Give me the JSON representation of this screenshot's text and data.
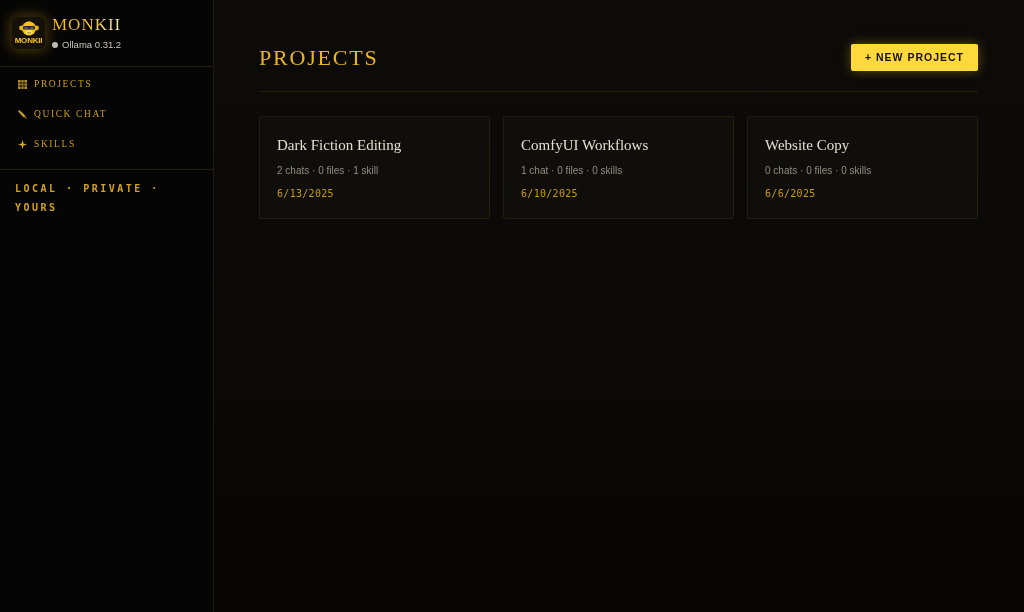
{
  "sidebar": {
    "brand": {
      "logo_text": "MONKII",
      "name": "MONKII",
      "status": "Ollama 0.31.2"
    },
    "nav": [
      {
        "label": "PROJECTS",
        "selected": false
      },
      {
        "label": "QUICK CHAT",
        "selected": false
      },
      {
        "label": "SKILLS",
        "selected": false
      }
    ],
    "footer": "LOCAL · PRIVATE · YOURS"
  },
  "main": {
    "title": "PROJECTS",
    "new_button": "+ NEW PROJECT",
    "projects": [
      {
        "name": "Dark Fiction Editing",
        "meta": "2 chats · 0 files · 1 skill",
        "date": "6/13/2025"
      },
      {
        "name": "ComfyUI Workflows",
        "meta": "1 chat · 0 files · 0 skills",
        "date": "6/10/2025"
      },
      {
        "name": "Website Copy",
        "meta": "0 chats · 0 files · 0 skills",
        "date": "6/6/2025"
      }
    ]
  }
}
